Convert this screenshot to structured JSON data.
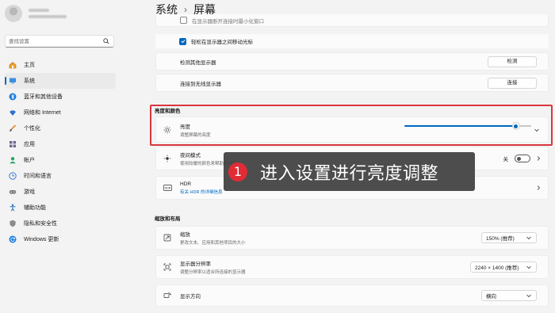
{
  "sidebar": {
    "search_placeholder": "查找设置",
    "items": [
      {
        "label": "主页",
        "icon": "home-icon"
      },
      {
        "label": "系统",
        "icon": "system-icon",
        "active": true
      },
      {
        "label": "蓝牙和其他设备",
        "icon": "bluetooth-icon"
      },
      {
        "label": "网络和 Internet",
        "icon": "wifi-icon"
      },
      {
        "label": "个性化",
        "icon": "brush-icon"
      },
      {
        "label": "应用",
        "icon": "apps-icon"
      },
      {
        "label": "帐户",
        "icon": "account-icon"
      },
      {
        "label": "时间和语言",
        "icon": "globe-clock-icon"
      },
      {
        "label": "游戏",
        "icon": "gamepad-icon"
      },
      {
        "label": "辅助功能",
        "icon": "accessibility-icon"
      },
      {
        "label": "隐私和安全性",
        "icon": "shield-icon"
      },
      {
        "label": "Windows 更新",
        "icon": "update-icon"
      }
    ]
  },
  "breadcrumb": {
    "parent": "系统",
    "separator": "›",
    "current": "屏幕"
  },
  "top_rows": {
    "row1_label": "在显示器断开连接时最小化窗口",
    "row2_label": "轻松在显示器之间移动光标",
    "detect_label": "检测其他显示器",
    "detect_button": "检测",
    "wireless_label": "连接到无线显示器",
    "wireless_button": "连接"
  },
  "brightness_section": {
    "title": "亮度和颜色",
    "brightness_label": "亮度",
    "brightness_sub": "调整屏幕的亮度",
    "brightness_value": 0.88,
    "night_label": "夜间模式",
    "night_sub": "使用较暖的颜色来帮助阻挡蓝光",
    "night_state": "关",
    "hdr_label": "HDR",
    "hdr_sub": "有关 HDR 的详细信息"
  },
  "scale_section": {
    "title": "缩放和布局",
    "scale_label": "缩放",
    "scale_sub": "更改文本、应用和其他项目的大小",
    "scale_value": "150% (推荐)",
    "resolution_label": "显示器分辨率",
    "resolution_sub": "调整分辨率以适合所连接的显示器",
    "resolution_value": "2240 × 1400 (推荐)",
    "orientation_label": "显示方向",
    "orientation_value": "横向"
  },
  "callout": {
    "number": "1",
    "text": "进入设置进行亮度调整"
  },
  "colors": {
    "accent": "#0067c0",
    "highlight": "#d9363e",
    "callout_bg": "#404040",
    "badge": "#e12c36"
  }
}
